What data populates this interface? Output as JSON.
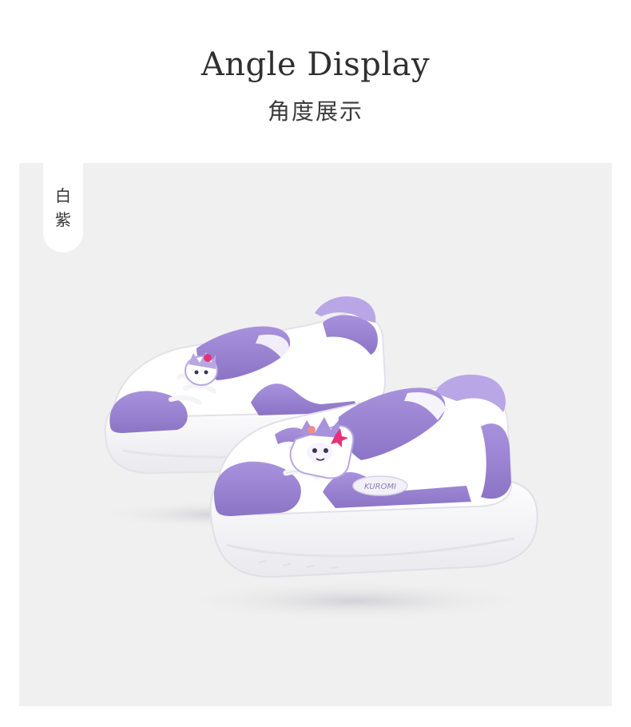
{
  "header": {
    "title": "Angle Display",
    "subtitle": "角度展示"
  },
  "color_tag": {
    "line1": "白",
    "line2": "紫"
  },
  "product_image": {
    "icon": "sneaker-pair-illustration",
    "brand_text": "KUROMI",
    "colors": {
      "primary": "#9a85d4",
      "secondary": "#ffffff",
      "lining": "#b9a6e6",
      "sole": "#f7f7f7",
      "charm_pink": "#e8307a"
    }
  }
}
